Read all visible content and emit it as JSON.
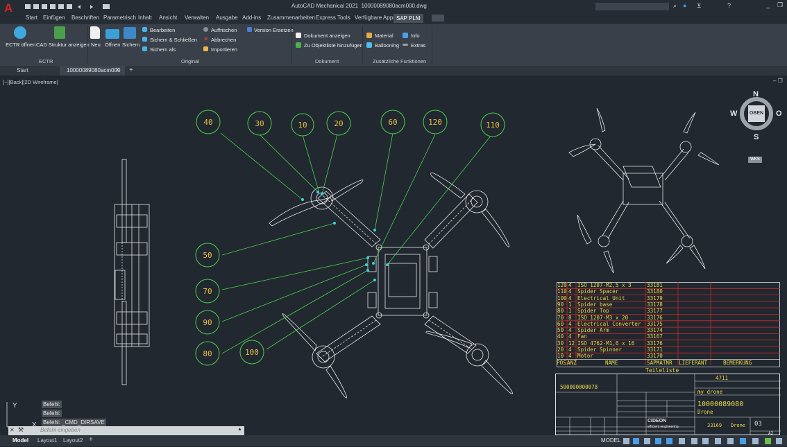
{
  "window": {
    "title": "AutoCAD Mechanical 2021",
    "filename": "10000089080acm000.dwg"
  },
  "menu": [
    "Start",
    "Einfügen",
    "Beschriften",
    "Parametrisch",
    "Inhalt",
    "Ansicht",
    "Verwalten",
    "Ausgabe",
    "Add-ins",
    "Zusammenarbeiten",
    "Express Tools",
    "Verfügbare Apps",
    "SAP PLM"
  ],
  "ribbon": {
    "ectr": {
      "open": "ECTR öffnen",
      "cad_structure": "CAD Struktur anzeigen",
      "group": "ECTR"
    },
    "original": {
      "new": "Neu",
      "open": "Öffnen",
      "save": "Sichern",
      "edit": "Bearbeiten",
      "save_close": "Sichern & Schließen",
      "save_as": "Sichern als",
      "refresh": "Auffrischen",
      "cancel": "Abbrechen",
      "import": "Importieren",
      "replace_version": "Version Ersetzen",
      "group": "Original"
    },
    "document": {
      "show": "Dokument anzeigen",
      "add_to_list": "Zu Objektliste hinzufügen",
      "group": "Dokument"
    },
    "extra": {
      "material": "Material",
      "info": "Info",
      "ballooning": "Ballooning",
      "extras": "Extras",
      "group": "Zusätzliche Funktionen"
    }
  },
  "tabs": {
    "start": "Start",
    "file": "10000089080acm000"
  },
  "viewport_label": "[−][Back][2D Wireframe]",
  "viewcube": {
    "n": "N",
    "s": "S",
    "w": "W",
    "o": "O",
    "face": "OBEN",
    "wcs": "WKS"
  },
  "balloons": [
    "40",
    "30",
    "10",
    "20",
    "60",
    "120",
    "110",
    "50",
    "70",
    "90",
    "80",
    "100"
  ],
  "parts_list": {
    "rows": [
      [
        "120",
        "4",
        "ISO 1207-M2,5 x 3",
        "33181"
      ],
      [
        "110",
        "4",
        "Spider Spacer",
        "33180"
      ],
      [
        "100",
        "4",
        "Electrical Unit",
        "33179"
      ],
      [
        "90",
        "1",
        "Spider base",
        "33178"
      ],
      [
        "80",
        "1",
        "Spider Top",
        "33177"
      ],
      [
        "70",
        "8",
        "ISO 1207-M3 x 20",
        "33176"
      ],
      [
        "60",
        "4",
        "Electrical Converter",
        "33175"
      ],
      [
        "50",
        "4",
        "Spider Arm",
        "33174"
      ],
      [
        "40",
        "4",
        "Fan",
        "33167"
      ],
      [
        "30",
        "12",
        "ISO 4762-M1,6 x 16",
        "33176"
      ],
      [
        "20",
        "4",
        "Spider Spinner",
        "33171"
      ],
      [
        "10",
        "4",
        "Motor",
        "33170"
      ]
    ],
    "header": {
      "pos": "POS.",
      "qty": "ANZ",
      "name": "NAME",
      "sap": "SAPMATNR",
      "supplier": "LIEFERANT",
      "remark": "BEMERKUNG"
    },
    "title": "Teileliste"
  },
  "title_block": {
    "project_number": "4711",
    "change_number": "500000000078",
    "description": "my drone",
    "drawing_number": "10000089080",
    "drawing_title": "Drone",
    "material_number": "33169",
    "material_text": "Drone",
    "sheet": "03",
    "format": "A2",
    "company": "CIDEON",
    "company_sub": "efficient engineering"
  },
  "command": {
    "history": [
      "Befehl:",
      "Befehl:",
      "Befehl: _CMD_DIRSAVE"
    ],
    "placeholder": "Befehl eingeben"
  },
  "layout_tabs": [
    "Model",
    "Layout1",
    "Layout2"
  ],
  "status": {
    "model": "MODEL"
  }
}
